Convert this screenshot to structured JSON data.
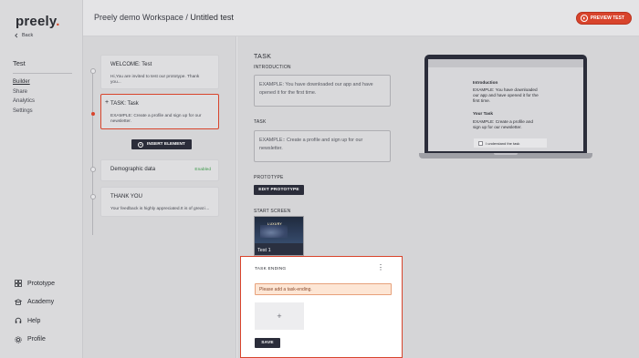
{
  "app": {
    "logo_text": "preely",
    "logo_dot": "."
  },
  "sidebar": {
    "back_label": "Back",
    "project_title": "Test",
    "nav": [
      "Builder",
      "Share",
      "Analytics",
      "Settings"
    ],
    "bottom_nav": [
      {
        "label": "Prototype",
        "icon": "grid-icon"
      },
      {
        "label": "Academy",
        "icon": "academy-icon"
      },
      {
        "label": "Help",
        "icon": "headset-icon"
      },
      {
        "label": "Profile",
        "icon": "profile-gear-icon"
      }
    ]
  },
  "header": {
    "workspace": "Preely demo Workspace /",
    "test_name": "Untitled test",
    "preview_label": "PREVIEW TEST"
  },
  "builder": {
    "cards": [
      {
        "title": "WELCOME:  Test",
        "desc": "Hi,You are invited to test our prototype. Thank you..."
      },
      {
        "title": "TASK:  Task",
        "desc": "EXAMPLE: Create a profile and sign up for our newsletter."
      },
      {
        "title": "Demographic data",
        "status": "Enabled"
      },
      {
        "title": "THANK YOU",
        "desc": "Your feedback is highly appreciated.It is of great i..."
      }
    ],
    "insert_label": "INSERT ELEMENT"
  },
  "editor": {
    "section_title": "TASK",
    "intro_label": "INTRODUCTION",
    "intro_text": "EXAMPLE: You have downloaded our app and have opened it for the first time.",
    "task_label": "TASK",
    "task_text": "EXAMPLE:: Create a profile and sign up for our newsletter.",
    "prototype_label": "PROTOTYPE",
    "edit_prototype_label": "EDIT PROTOTYPE",
    "start_screen_label": "START SCREEN",
    "start_screen_name": "Test 1",
    "thumb_brand": "LUXURY"
  },
  "preview": {
    "intro_heading": "Introduction",
    "intro_text": "EXAMPLE: You have downloaded our app and have opened it for the first time.",
    "task_heading": "Your Task",
    "task_text": "EXAMPLE: Create a profile and sign up for our newsletter.",
    "checkbox_label": "I understand the task"
  },
  "modal": {
    "title": "TASK ENDING",
    "menu_glyph": "⋮",
    "warning": "Please add a task-ending.",
    "add_glyph": "+",
    "save_label": "SAVE"
  },
  "colors": {
    "accent": "#d8442c",
    "dark_button": "#2b2d3a",
    "enabled": "#3f9a4c"
  }
}
